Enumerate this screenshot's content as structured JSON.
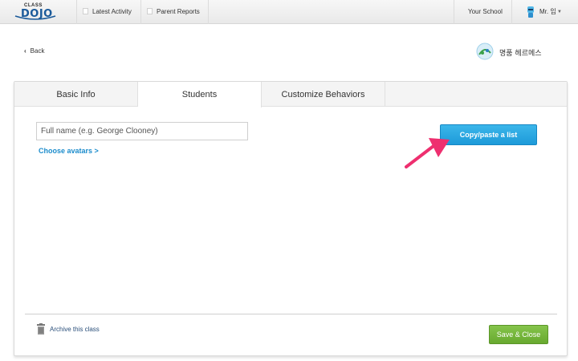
{
  "nav": {
    "logo_small": "CLASS",
    "logo_big": "DOJO",
    "latest_activity": "Latest Activity",
    "parent_reports": "Parent Reports",
    "your_school": "Your School",
    "user_name": "Mr. 임"
  },
  "page": {
    "back_label": "Back",
    "school_name": "명품 헤르메스"
  },
  "tabs": [
    {
      "label": "Basic Info"
    },
    {
      "label": "Students"
    },
    {
      "label": "Customize Behaviors"
    }
  ],
  "students": {
    "name_placeholder": "Full name (e.g. George Clooney)",
    "choose_avatars": "Choose avatars >",
    "copy_paste_label": "Copy/paste a list"
  },
  "footer": {
    "archive_label": "Archive this class",
    "save_label": "Save & Close"
  },
  "colors": {
    "primary_button": "#1d9ad9",
    "save_button": "#68a92f",
    "link": "#1b8ccc",
    "annotation_arrow": "#ee2f6f"
  },
  "icons": {
    "back": "chevron-left-icon",
    "archive": "trash-icon",
    "annotation": "pink-arrow-icon"
  }
}
